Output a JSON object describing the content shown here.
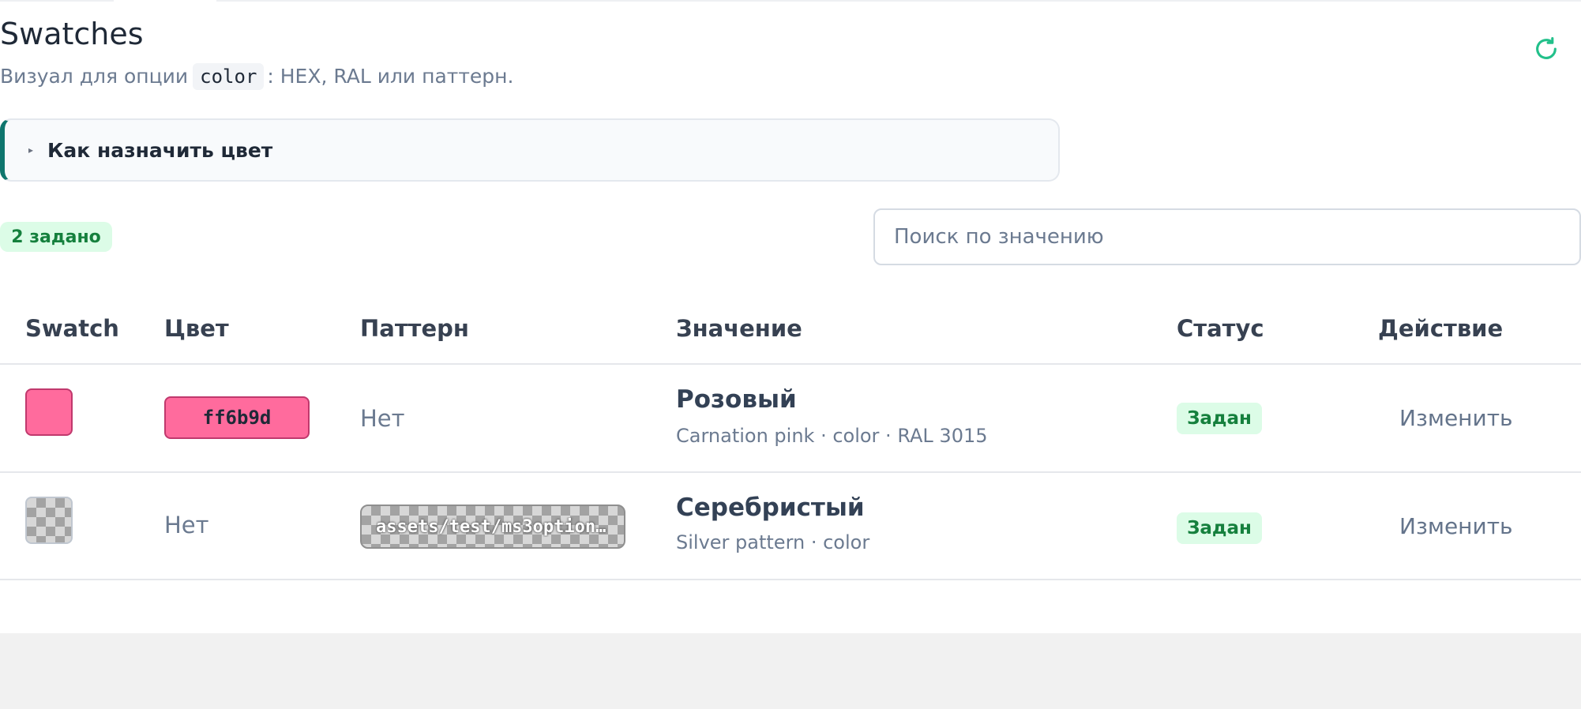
{
  "header": {
    "title": "Swatches",
    "subtitle_prefix": "Визуал для опции",
    "subtitle_code": "color",
    "subtitle_suffix": ": HEX, RAL или паттерн."
  },
  "refresh": {
    "icon": "refresh-icon",
    "color": "#22c08a"
  },
  "help": {
    "label": "Как назначить цвет",
    "accent": "#0f766e"
  },
  "count_badge": "2 задано",
  "search": {
    "placeholder": "Поиск по значению",
    "value": ""
  },
  "table": {
    "columns": [
      "Swatch",
      "Цвет",
      "Паттерн",
      "Значение",
      "Статус",
      "Действие"
    ],
    "rows": [
      {
        "swatch_color": "#ff6b9d",
        "color_hex": "ff6b9d",
        "pattern": "Нет",
        "value_title": "Розовый",
        "value_sub": "Carnation pink · color · RAL 3015",
        "status": "Задан",
        "action": "Изменить"
      },
      {
        "swatch_color": "checker",
        "color_hex": "Нет",
        "pattern": "assets/test/ms3options/silver-pattern.png",
        "value_title": "Серебристый",
        "value_sub": "Silver pattern · color",
        "status": "Задан",
        "action": "Изменить"
      }
    ]
  }
}
